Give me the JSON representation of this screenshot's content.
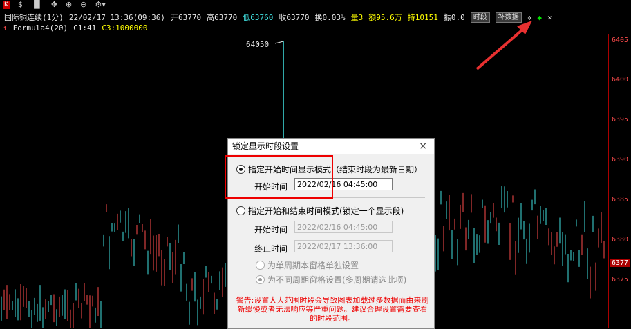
{
  "toolbar": {
    "k_label": "K",
    "dollar": "$",
    "icons": [
      "crosshair-icon",
      "zoom-in-icon",
      "zoom-out-icon",
      "gear-icon"
    ]
  },
  "info": {
    "symbol": "国际铜连续(1分)",
    "datetime": "22/02/17 13:36(09:36)",
    "open": "开63770",
    "high": "高63770",
    "low": "低63760",
    "close": "收63770",
    "turnover_rate": "换0.03%",
    "volume": "量3",
    "amount": "额95.6万",
    "position": "持10151",
    "amplitude": "振0.0",
    "btn_period": "时段",
    "btn_fill": "补数据"
  },
  "formula": {
    "name": "Formula4(20)",
    "c1": "C1:41",
    "c3": "C3:1000000"
  },
  "chart": {
    "price_label": "64050",
    "axis_ticks": [
      "6405",
      "6400",
      "6395",
      "6390",
      "6385",
      "6380",
      "6375"
    ],
    "last_price": "6377"
  },
  "dialog": {
    "title": "锁定显示时段设置",
    "close": "×",
    "mode1_label": "指定开始时间显示模式（结束时段为最新日期）",
    "start_label_1": "开始时间",
    "start_value_1": "2022/02/16  04:45:00",
    "mode2_label": "指定开始和结束时间模式(锁定一个显示段)",
    "start_label_2": "开始时间",
    "start_value_2": "2022/02/16  04:45:00",
    "end_label": "终止时间",
    "end_value": "2022/02/17  13:36:00",
    "sub_option_1": "为单周期本窗格单独设置",
    "sub_option_2": "为不同周期窗格设置(多周期请选此项)",
    "warning": "警告:设置大大范围时段会导致图表加载过多数据而由来刷新缓慢或者无法响应等严重问题。建议合理设置需要查看的时段范围。"
  },
  "colors": {
    "up": "#ff4c4c",
    "down": "#40e0e0",
    "highlight": "#e00000"
  }
}
